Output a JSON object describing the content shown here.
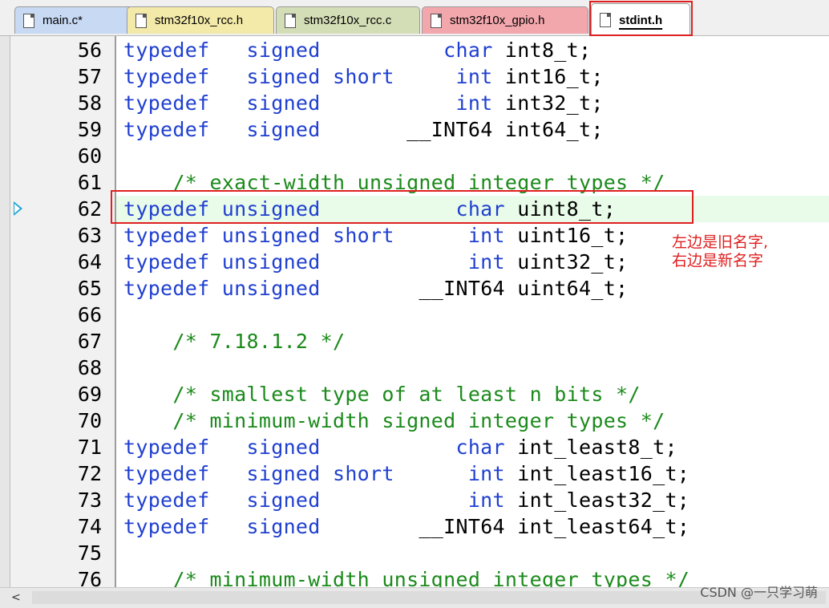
{
  "tabs": [
    {
      "label": "main.c*",
      "color": "#c7d9f3",
      "active": false
    },
    {
      "label": "stm32f10x_rcc.h",
      "color": "#f3e9a8",
      "active": false
    },
    {
      "label": "stm32f10x_rcc.c",
      "color": "#d3ddb6",
      "active": false
    },
    {
      "label": "stm32f10x_gpio.h",
      "color": "#f2a7ad",
      "active": false
    },
    {
      "label": "stdint.h",
      "color": "#ffffff",
      "active": true
    }
  ],
  "code_lines": [
    {
      "num": "56",
      "parts": [
        [
          "kw",
          "typedef   signed          "
        ],
        [
          "kw",
          "char"
        ],
        [
          "id",
          " int8_t;"
        ]
      ]
    },
    {
      "num": "57",
      "parts": [
        [
          "kw",
          "typedef   signed short     int"
        ],
        [
          "id",
          " int16_t;"
        ]
      ]
    },
    {
      "num": "58",
      "parts": [
        [
          "kw",
          "typedef   signed           int"
        ],
        [
          "id",
          " int32_t;"
        ]
      ]
    },
    {
      "num": "59",
      "parts": [
        [
          "kw",
          "typedef   signed       "
        ],
        [
          "id",
          "__INT64 int64_t;"
        ]
      ]
    },
    {
      "num": "60",
      "parts": []
    },
    {
      "num": "61",
      "parts": [
        [
          "cm",
          "    /* exact-width unsigned integer types */"
        ]
      ]
    },
    {
      "num": "62",
      "parts": [
        [
          "kw",
          "typedef unsigned           char"
        ],
        [
          "id",
          " uint8_t;"
        ]
      ],
      "current": true
    },
    {
      "num": "63",
      "parts": [
        [
          "kw",
          "typedef unsigned short      int"
        ],
        [
          "id",
          " uint16_t;"
        ]
      ]
    },
    {
      "num": "64",
      "parts": [
        [
          "kw",
          "typedef unsigned            int"
        ],
        [
          "id",
          " uint32_t;"
        ]
      ]
    },
    {
      "num": "65",
      "parts": [
        [
          "kw",
          "typedef unsigned        "
        ],
        [
          "id",
          "__INT64 uint64_t;"
        ]
      ]
    },
    {
      "num": "66",
      "parts": []
    },
    {
      "num": "67",
      "parts": [
        [
          "cm",
          "    /* 7.18.1.2 */"
        ]
      ]
    },
    {
      "num": "68",
      "parts": []
    },
    {
      "num": "69",
      "parts": [
        [
          "cm",
          "    /* smallest type of at least n bits */"
        ]
      ]
    },
    {
      "num": "70",
      "parts": [
        [
          "cm",
          "    /* minimum-width signed integer types */"
        ]
      ]
    },
    {
      "num": "71",
      "parts": [
        [
          "kw",
          "typedef   signed           char"
        ],
        [
          "id",
          " int_least8_t;"
        ]
      ]
    },
    {
      "num": "72",
      "parts": [
        [
          "kw",
          "typedef   signed short      int"
        ],
        [
          "id",
          " int_least16_t;"
        ]
      ]
    },
    {
      "num": "73",
      "parts": [
        [
          "kw",
          "typedef   signed            int"
        ],
        [
          "id",
          " int_least32_t;"
        ]
      ]
    },
    {
      "num": "74",
      "parts": [
        [
          "kw",
          "typedef   signed        "
        ],
        [
          "id",
          "__INT64 int_least64_t;"
        ]
      ]
    },
    {
      "num": "75",
      "parts": []
    },
    {
      "num": "76",
      "parts": [
        [
          "cm",
          "    /* minimum-width unsigned integer types */"
        ]
      ]
    }
  ],
  "annotation": {
    "line1": "左边是旧名字,",
    "line2": "右边是新名字"
  },
  "scrollbar": {
    "left_arrow": "<"
  },
  "watermark": "CSDN @一只学习萌",
  "colors": {
    "keyword": "#1f3fd0",
    "comment": "#1b8a1b",
    "highlight_box": "#e02020",
    "current_line": "#e9fbe9"
  }
}
